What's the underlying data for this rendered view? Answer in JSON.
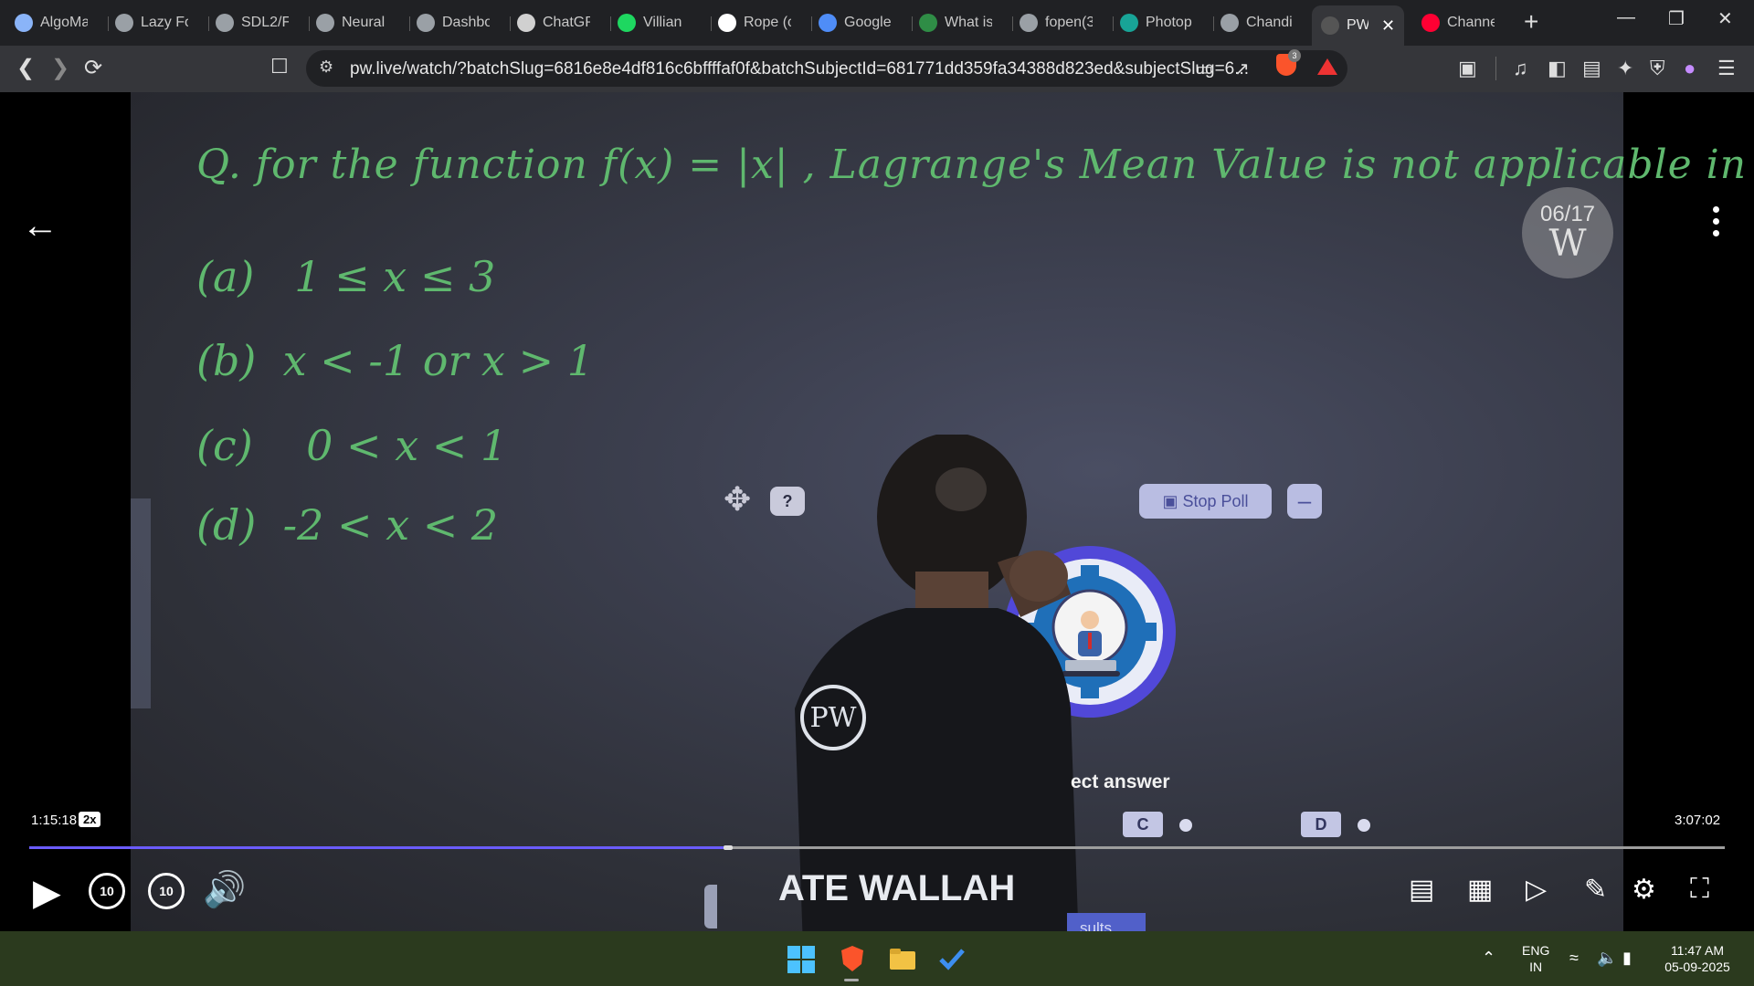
{
  "browser": {
    "tabs": [
      {
        "label": "AlgoMa",
        "icon": "algomaster-icon",
        "color": "#8ab4f8"
      },
      {
        "label": "Lazy Fo",
        "icon": "globe-icon",
        "color": "#9aa0a6"
      },
      {
        "label": "SDL2/F",
        "icon": "github-icon",
        "color": "#9aa0a6"
      },
      {
        "label": "Neural",
        "icon": "globe-icon",
        "color": "#9aa0a6"
      },
      {
        "label": "Dashbo",
        "icon": "github-icon",
        "color": "#9aa0a6"
      },
      {
        "label": "ChatGP",
        "icon": "openai-icon",
        "color": "#d0d0d0"
      },
      {
        "label": "Villian",
        "icon": "spotify-icon",
        "color": "#1ed760"
      },
      {
        "label": "Rope (c",
        "icon": "wikipedia-icon",
        "color": "#ffffff"
      },
      {
        "label": "Google",
        "icon": "gemini-icon",
        "color": "#4f8df7"
      },
      {
        "label": "What is",
        "icon": "gfg-icon",
        "color": "#2f8d46"
      },
      {
        "label": "fopen(3",
        "icon": "globe-icon",
        "color": "#9aa0a6"
      },
      {
        "label": "Photop",
        "icon": "photopea-icon",
        "color": "#18a497"
      },
      {
        "label": "Chandi",
        "icon": "globe-icon",
        "color": "#9aa0a6"
      },
      {
        "label": "PW",
        "icon": "pw-icon",
        "color": "#555555",
        "active": true
      },
      {
        "label": "Channe",
        "icon": "youtube-icon",
        "color": "#ff0033"
      }
    ],
    "new_tab": "+",
    "url": "pw.live/watch/?batchSlug=6816e8e4df816c6bffffaf0f&batchSubjectId=681771dd359fa34388d823ed&subjectSlug=6...",
    "shield_count": "3"
  },
  "video": {
    "question": "Q. for the function f(x) = |x| , Lagrange's Mean Value is not applicable in ?",
    "options": [
      {
        "label": "(a)",
        "text": "1 ≤ x ≤ 3"
      },
      {
        "label": "(b)",
        "text": "x < -1 or x > 1"
      },
      {
        "label": "(c)",
        "text": "0 < x < 1"
      },
      {
        "label": "(d)",
        "text": "-2 < x < 2"
      }
    ],
    "watermark_top": "06/17",
    "watermark_logo": "W",
    "tshirt_logo": "PW",
    "tshirt_text": "ATE WALLAH"
  },
  "poll": {
    "stop_label": "Stop Poll",
    "minimize_label": "–",
    "help_label": "?",
    "prompt_visible": "ect answer",
    "options_visible": [
      "C",
      "D"
    ],
    "results_visible": "sults"
  },
  "player": {
    "current_time": "1:15:18",
    "speed": "2x",
    "total_time": "3:07:02",
    "progress": 0.412,
    "rewind_label": "10",
    "forward_label": "10"
  },
  "taskbar": {
    "lang_top": "ENG",
    "lang_bottom": "IN",
    "time": "11:47 AM",
    "date": "05-09-2025"
  }
}
